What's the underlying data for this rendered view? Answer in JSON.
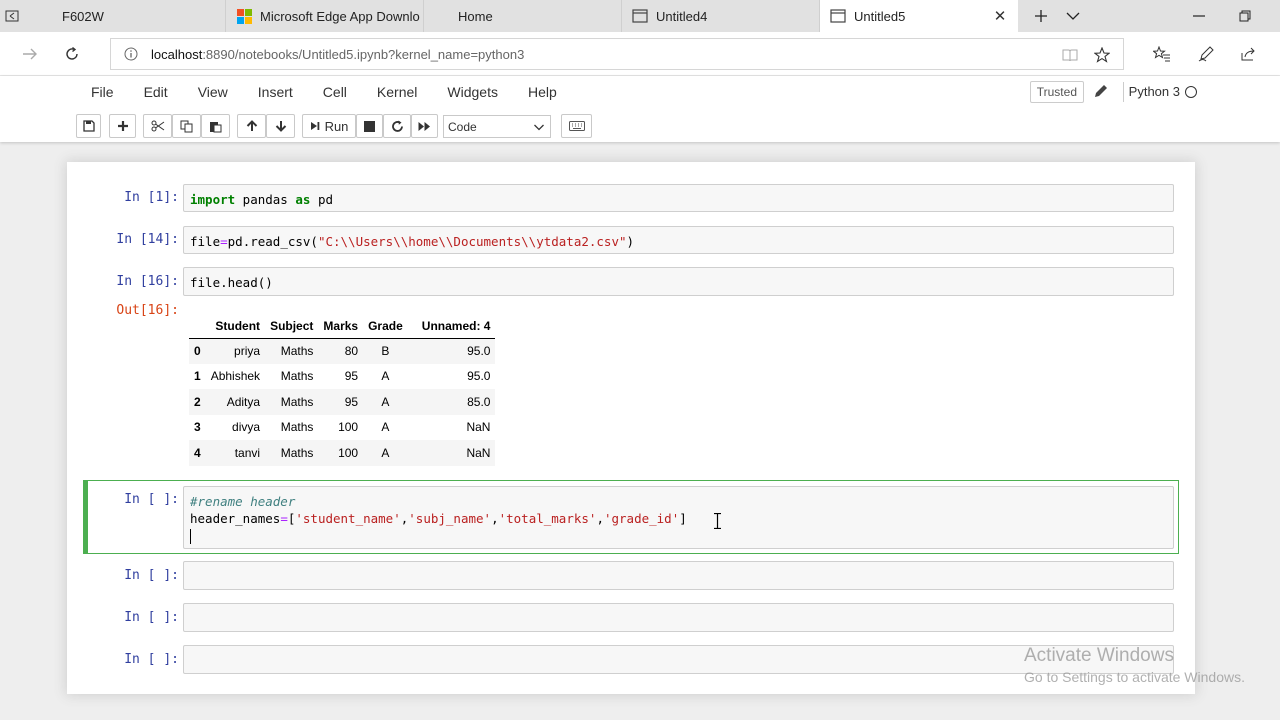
{
  "browser": {
    "tabs": [
      {
        "title": "F602W",
        "icon": "back-arrow-icon"
      },
      {
        "title": "Microsoft Edge App Downlo",
        "icon": "microsoft-logo-icon"
      },
      {
        "title": "Home",
        "icon": ""
      },
      {
        "title": "Untitled4",
        "icon": "page-icon"
      },
      {
        "title": "Untitled5",
        "icon": "page-icon",
        "active": true
      }
    ],
    "url_host": "localhost",
    "url_rest": ":8890/notebooks/Untitled5.ipynb?kernel_name=python3"
  },
  "jupyter": {
    "menu": [
      "File",
      "Edit",
      "View",
      "Insert",
      "Cell",
      "Kernel",
      "Widgets",
      "Help"
    ],
    "trusted_label": "Trusted",
    "kernel_name": "Python 3",
    "toolbar": {
      "run_label": "Run",
      "cell_type": "Code"
    }
  },
  "cells": [
    {
      "prompt": "In [1]:"
    },
    {
      "prompt": "In [14]:"
    },
    {
      "prompt": "In [16]:",
      "out_prompt": "Out[16]:"
    },
    {
      "prompt": "In [ ]:"
    },
    {
      "prompt": "In [ ]:"
    },
    {
      "prompt": "In [ ]:"
    },
    {
      "prompt": "In [ ]:"
    }
  ],
  "code": {
    "c1": {
      "kw1": "import",
      "mod": " pandas ",
      "kw2": "as",
      "alias": " pd"
    },
    "c2": {
      "lhs": "file",
      "eq": "=",
      "call": "pd.read_csv(",
      "str": "\"C:\\\\Users\\\\home\\\\Documents\\\\ytdata2.csv\"",
      "close": ")"
    },
    "c3": {
      "text": "file.head",
      "parens": "()"
    },
    "c4": {
      "comment": "#rename header",
      "lhs": "header_names",
      "eq": "=",
      "open": "[",
      "s1": "'student_name'",
      "s2": "'subj_name'",
      "s3": "'total_marks'",
      "s4": "'grade_id'",
      "close": "]",
      "comma": ","
    }
  },
  "dataframe": {
    "columns": [
      "",
      "Student",
      "Subject",
      "Marks",
      "Grade",
      "Unnamed: 4"
    ],
    "rows": [
      [
        "0",
        "priya",
        "Maths",
        "80",
        "B",
        "95.0"
      ],
      [
        "1",
        "Abhishek",
        "Maths",
        "95",
        "A",
        "95.0"
      ],
      [
        "2",
        "Aditya",
        "Maths",
        "95",
        "A",
        "85.0"
      ],
      [
        "3",
        "divya",
        "Maths",
        "100",
        "A",
        "NaN"
      ],
      [
        "4",
        "tanvi",
        "Maths",
        "100",
        "A",
        "NaN"
      ]
    ]
  },
  "watermark": {
    "line1": "Activate Windows",
    "line2": "Go to Settings to activate Windows."
  },
  "colors": {
    "selected_cell_border": "#4caf50",
    "in_prompt": "#303f9f",
    "out_prompt": "#d84315",
    "keyword": "#008000",
    "string": "#ba2121"
  }
}
